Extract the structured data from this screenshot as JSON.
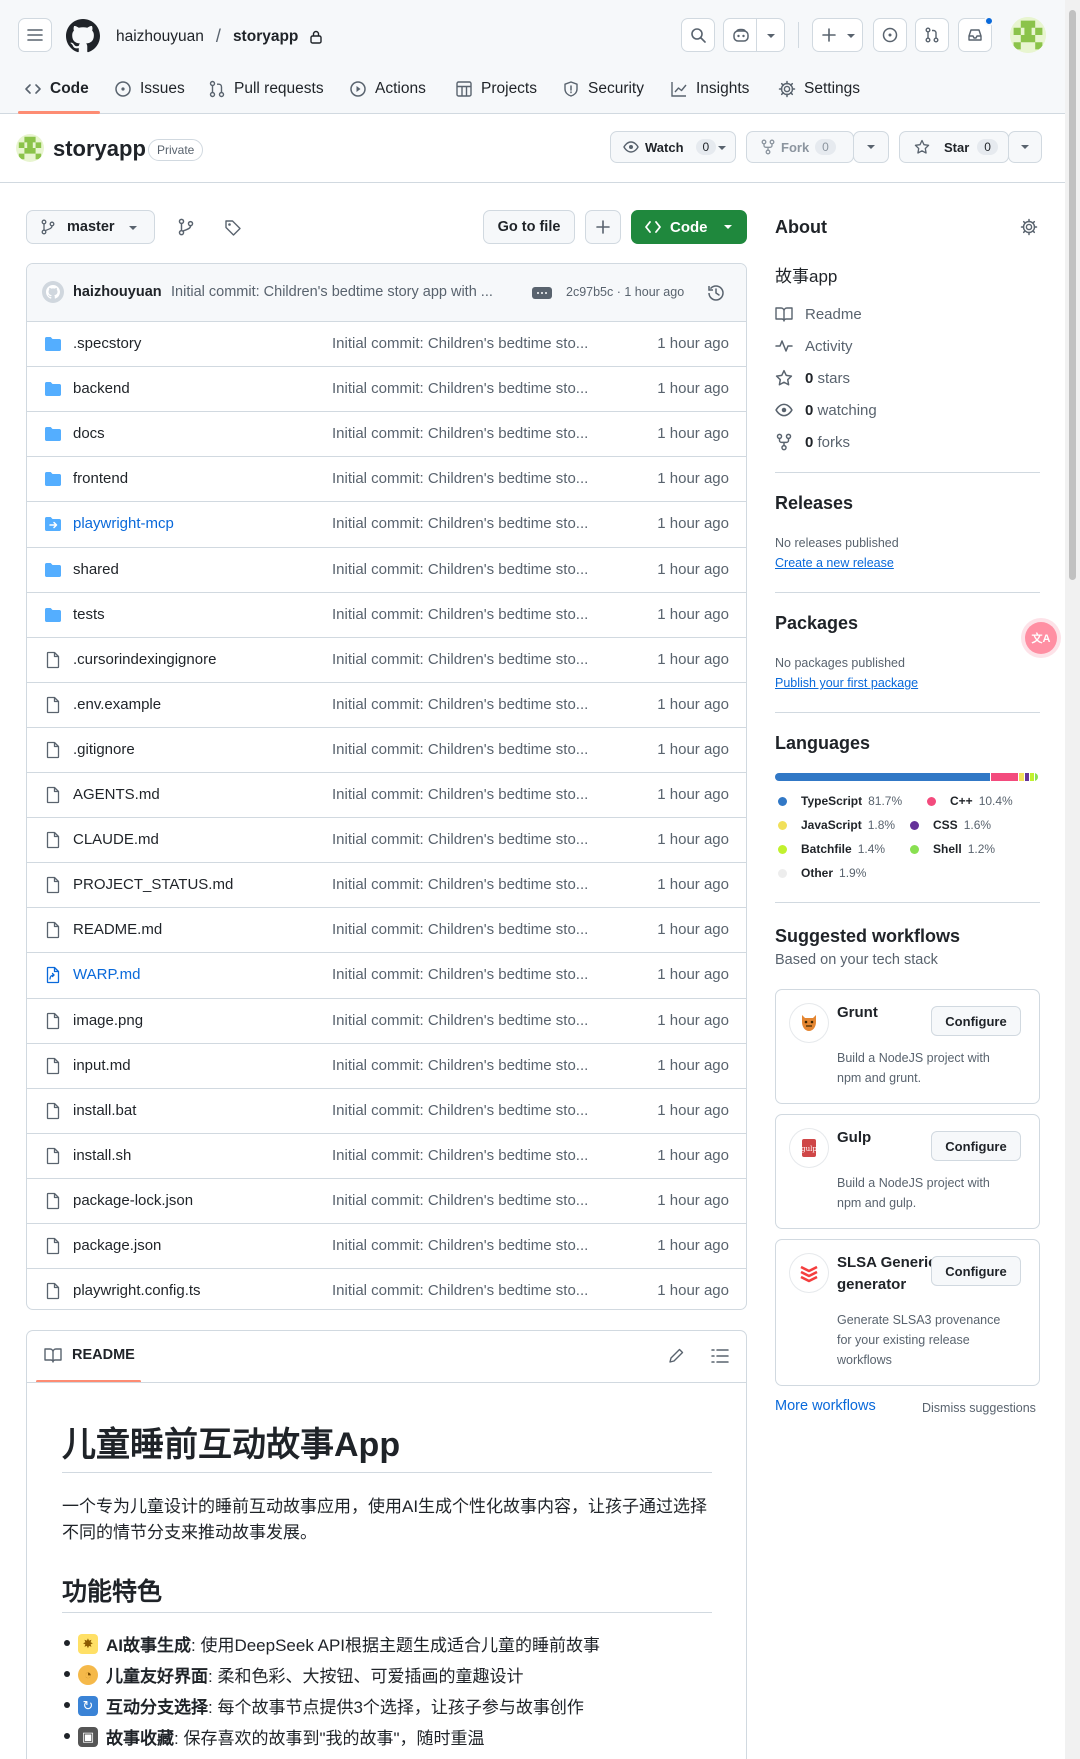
{
  "header": {
    "owner": "haizhouyuan",
    "separator": "/",
    "repo": "storyapp"
  },
  "tabs": [
    {
      "label": "Code",
      "icon": "code-icon"
    },
    {
      "label": "Issues",
      "icon": "issue-icon"
    },
    {
      "label": "Pull requests",
      "icon": "pull-request-icon"
    },
    {
      "label": "Actions",
      "icon": "play-icon"
    },
    {
      "label": "Projects",
      "icon": "table-icon"
    },
    {
      "label": "Security",
      "icon": "shield-icon"
    },
    {
      "label": "Insights",
      "icon": "graph-icon"
    },
    {
      "label": "Settings",
      "icon": "gear-icon"
    }
  ],
  "repo": {
    "name": "storyapp",
    "visibility": "Private",
    "watch_label": "Watch",
    "watch_count": "0",
    "fork_label": "Fork",
    "fork_count": "0",
    "star_label": "Star",
    "star_count": "0"
  },
  "toolbar": {
    "branch": "master",
    "go_to_file": "Go to file",
    "code_label": "Code"
  },
  "commit": {
    "author": "haizhouyuan",
    "message": "Initial commit: Children's bedtime story app with ...",
    "hash_time": "2c97b5c · 1 hour ago"
  },
  "files": [
    {
      "name": ".specstory",
      "type": "folder",
      "message": "Initial commit: Children's bedtime sto...",
      "time": "1 hour ago"
    },
    {
      "name": "backend",
      "type": "folder",
      "message": "Initial commit: Children's bedtime sto...",
      "time": "1 hour ago"
    },
    {
      "name": "docs",
      "type": "folder",
      "message": "Initial commit: Children's bedtime sto...",
      "time": "1 hour ago"
    },
    {
      "name": "frontend",
      "type": "folder",
      "message": "Initial commit: Children's bedtime sto...",
      "time": "1 hour ago"
    },
    {
      "name": "playwright-mcp",
      "type": "submodule",
      "message": "Initial commit: Children's bedtime sto...",
      "time": "1 hour ago"
    },
    {
      "name": "shared",
      "type": "folder",
      "message": "Initial commit: Children's bedtime sto...",
      "time": "1 hour ago"
    },
    {
      "name": "tests",
      "type": "folder",
      "message": "Initial commit: Children's bedtime sto...",
      "time": "1 hour ago"
    },
    {
      "name": ".cursorindexingignore",
      "type": "file",
      "message": "Initial commit: Children's bedtime sto...",
      "time": "1 hour ago"
    },
    {
      "name": ".env.example",
      "type": "file",
      "message": "Initial commit: Children's bedtime sto...",
      "time": "1 hour ago"
    },
    {
      "name": ".gitignore",
      "type": "file",
      "message": "Initial commit: Children's bedtime sto...",
      "time": "1 hour ago"
    },
    {
      "name": "AGENTS.md",
      "type": "file",
      "message": "Initial commit: Children's bedtime sto...",
      "time": "1 hour ago"
    },
    {
      "name": "CLAUDE.md",
      "type": "file",
      "message": "Initial commit: Children's bedtime sto...",
      "time": "1 hour ago"
    },
    {
      "name": "PROJECT_STATUS.md",
      "type": "file",
      "message": "Initial commit: Children's bedtime sto...",
      "time": "1 hour ago"
    },
    {
      "name": "README.md",
      "type": "file",
      "message": "Initial commit: Children's bedtime sto...",
      "time": "1 hour ago"
    },
    {
      "name": "WARP.md",
      "type": "symlink",
      "message": "Initial commit: Children's bedtime sto...",
      "time": "1 hour ago"
    },
    {
      "name": "image.png",
      "type": "file",
      "message": "Initial commit: Children's bedtime sto...",
      "time": "1 hour ago"
    },
    {
      "name": "input.md",
      "type": "file",
      "message": "Initial commit: Children's bedtime sto...",
      "time": "1 hour ago"
    },
    {
      "name": "install.bat",
      "type": "file",
      "message": "Initial commit: Children's bedtime sto...",
      "time": "1 hour ago"
    },
    {
      "name": "install.sh",
      "type": "file",
      "message": "Initial commit: Children's bedtime sto...",
      "time": "1 hour ago"
    },
    {
      "name": "package-lock.json",
      "type": "file",
      "message": "Initial commit: Children's bedtime sto...",
      "time": "1 hour ago"
    },
    {
      "name": "package.json",
      "type": "file",
      "message": "Initial commit: Children's bedtime sto...",
      "time": "1 hour ago"
    },
    {
      "name": "playwright.config.ts",
      "type": "file",
      "message": "Initial commit: Children's bedtime sto...",
      "time": "1 hour ago"
    }
  ],
  "readme": {
    "tab_label": "README",
    "h1": "儿童睡前互动故事App",
    "intro": "一个专为儿童设计的睡前互动故事应用，使用AI生成个性化故事内容，让孩子通过选择不同的情节分支来推动故事发展。",
    "h2": "功能特色",
    "features": [
      {
        "title": "AI故事生成",
        "text": ": 使用DeepSeek API根据主题生成适合儿童的睡前故事",
        "icon": "sparkle-icon"
      },
      {
        "title": "儿童友好界面",
        "text": ": 柔和色彩、大按钮、可爱插画的童趣设计",
        "icon": "palette-icon"
      },
      {
        "title": "互动分支选择",
        "text": ": 每个故事节点提供3个选择，让孩子参与故事创作",
        "icon": "cycle-icon"
      },
      {
        "title": "故事收藏",
        "text": ": 保存喜欢的故事到\"我的故事\"，随时重温",
        "icon": "floppy-icon"
      }
    ]
  },
  "about": {
    "title": "About",
    "description": "故事app",
    "readme": "Readme",
    "activity": "Activity",
    "stars": "0 stars",
    "stars_count": "0",
    "stars_word": "stars",
    "watching_count": "0",
    "watching_word": "watching",
    "forks_count": "0",
    "forks_word": "forks"
  },
  "releases": {
    "title": "Releases",
    "none": "No releases published",
    "link": "Create a new release"
  },
  "packages": {
    "title": "Packages",
    "none": "No packages published",
    "link": "Publish your first package"
  },
  "languages": {
    "title": "Languages",
    "items": [
      {
        "name": "TypeScript",
        "percent": "81.7%",
        "value": 81.7,
        "color": "#3178c6"
      },
      {
        "name": "C++",
        "percent": "10.4%",
        "value": 10.4,
        "color": "#f34b7d"
      },
      {
        "name": "JavaScript",
        "percent": "1.8%",
        "value": 1.8,
        "color": "#f1e05a"
      },
      {
        "name": "CSS",
        "percent": "1.6%",
        "value": 1.6,
        "color": "#663399"
      },
      {
        "name": "Batchfile",
        "percent": "1.4%",
        "value": 1.4,
        "color": "#c1f12e"
      },
      {
        "name": "Shell",
        "percent": "1.2%",
        "value": 1.2,
        "color": "#89e051"
      },
      {
        "name": "Other",
        "percent": "1.9%",
        "value": 1.9,
        "color": "#ededed"
      }
    ]
  },
  "workflows": {
    "title": "Suggested workflows",
    "subtitle": "Based on your tech stack",
    "items": [
      {
        "name": "Grunt",
        "desc": "Build a NodeJS project with npm and grunt.",
        "button": "Configure"
      },
      {
        "name": "Gulp",
        "desc": "Build a NodeJS project with npm and gulp.",
        "button": "Configure"
      },
      {
        "name": "SLSA Generic generator",
        "desc": "Generate SLSA3 provenance for your existing release workflows",
        "button": "Configure"
      }
    ],
    "more": "More workflows",
    "dismiss": "Dismiss suggestions"
  },
  "colors": {
    "accent_green": "#1f883d",
    "link_blue": "#0969da",
    "folder_blue": "#54aeff",
    "tab_underline": "#fd8c73",
    "border": "#d1d9e0"
  }
}
